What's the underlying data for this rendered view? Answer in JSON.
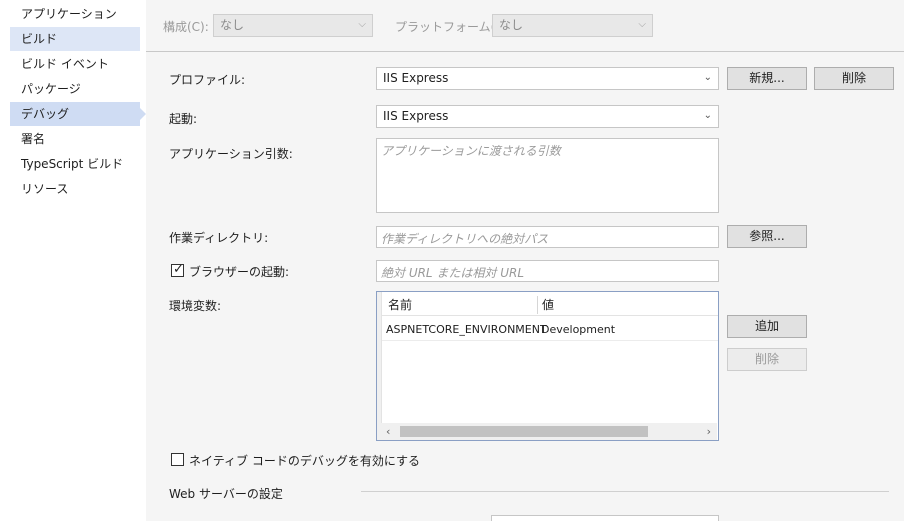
{
  "sidebar": {
    "items": [
      {
        "label": "アプリケーション"
      },
      {
        "label": "ビルド"
      },
      {
        "label": "ビルド イベント"
      },
      {
        "label": "パッケージ"
      },
      {
        "label": "デバッグ"
      },
      {
        "label": "署名"
      },
      {
        "label": "TypeScript ビルド"
      },
      {
        "label": "リソース"
      }
    ]
  },
  "config_bar": {
    "configuration_label": "構成(C):",
    "configuration_value": "なし",
    "platform_label": "プラットフォーム(M):",
    "platform_value": "なし"
  },
  "profile": {
    "label": "プロファイル:",
    "value": "IIS Express",
    "new_button": "新規...",
    "delete_button": "削除"
  },
  "launch": {
    "label": "起動:",
    "value": "IIS Express"
  },
  "app_args": {
    "label": "アプリケーション引数:",
    "placeholder": "アプリケーションに渡される引数"
  },
  "working_dir": {
    "label": "作業ディレクトリ:",
    "placeholder": "作業ディレクトリへの絶対パス",
    "browse_button": "参照..."
  },
  "launch_browser": {
    "label": "ブラウザーの起動:",
    "checked": true,
    "check_glyph": "✓",
    "placeholder": "絶対 URL または相対 URL"
  },
  "env_vars": {
    "label": "環境変数:",
    "columns": [
      "名前",
      "値"
    ],
    "rows": [
      {
        "name": "ASPNETCORE_ENVIRONMENT",
        "value": "Development"
      }
    ],
    "add_button": "追加",
    "delete_button": "削除"
  },
  "native_debug": {
    "label": "ネイティブ コードのデバッグを有効にする",
    "checked": false
  },
  "web_server": {
    "section_label": "Web サーバーの設定"
  }
}
